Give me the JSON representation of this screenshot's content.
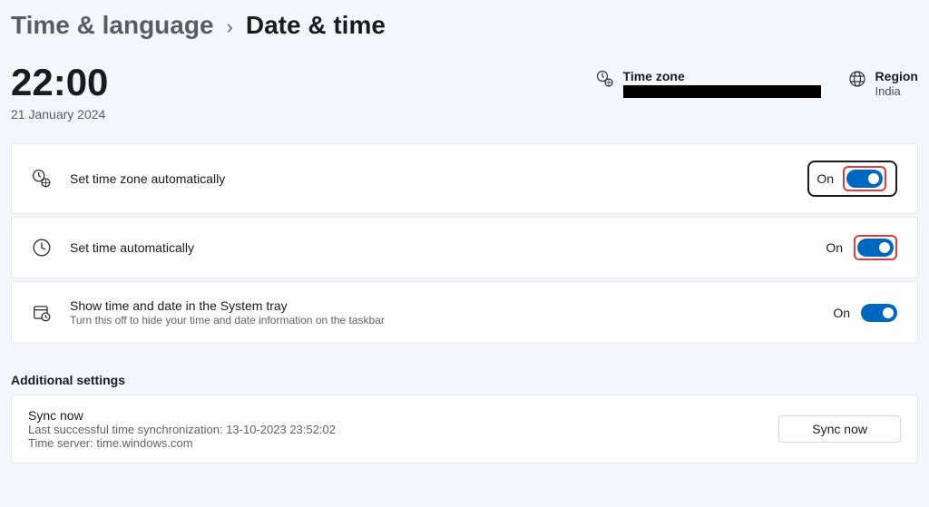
{
  "breadcrumb": {
    "parent": "Time & language",
    "current": "Date & time"
  },
  "clock": {
    "time": "22:00",
    "date": "21 January 2024"
  },
  "timezone": {
    "label": "Time zone",
    "value": ""
  },
  "region": {
    "label": "Region",
    "value": "India"
  },
  "settings": {
    "auto_tz": {
      "title": "Set time zone automatically",
      "state": "On"
    },
    "auto_time": {
      "title": "Set time automatically",
      "state": "On"
    },
    "tray": {
      "title": "Show time and date in the System tray",
      "subtitle": "Turn this off to hide your time and date information on the taskbar",
      "state": "On"
    }
  },
  "additional": {
    "heading": "Additional settings",
    "sync": {
      "title": "Sync now",
      "last": "Last successful time synchronization: 13-10-2023 23:52:02",
      "server": "Time server: time.windows.com",
      "button": "Sync now"
    }
  }
}
